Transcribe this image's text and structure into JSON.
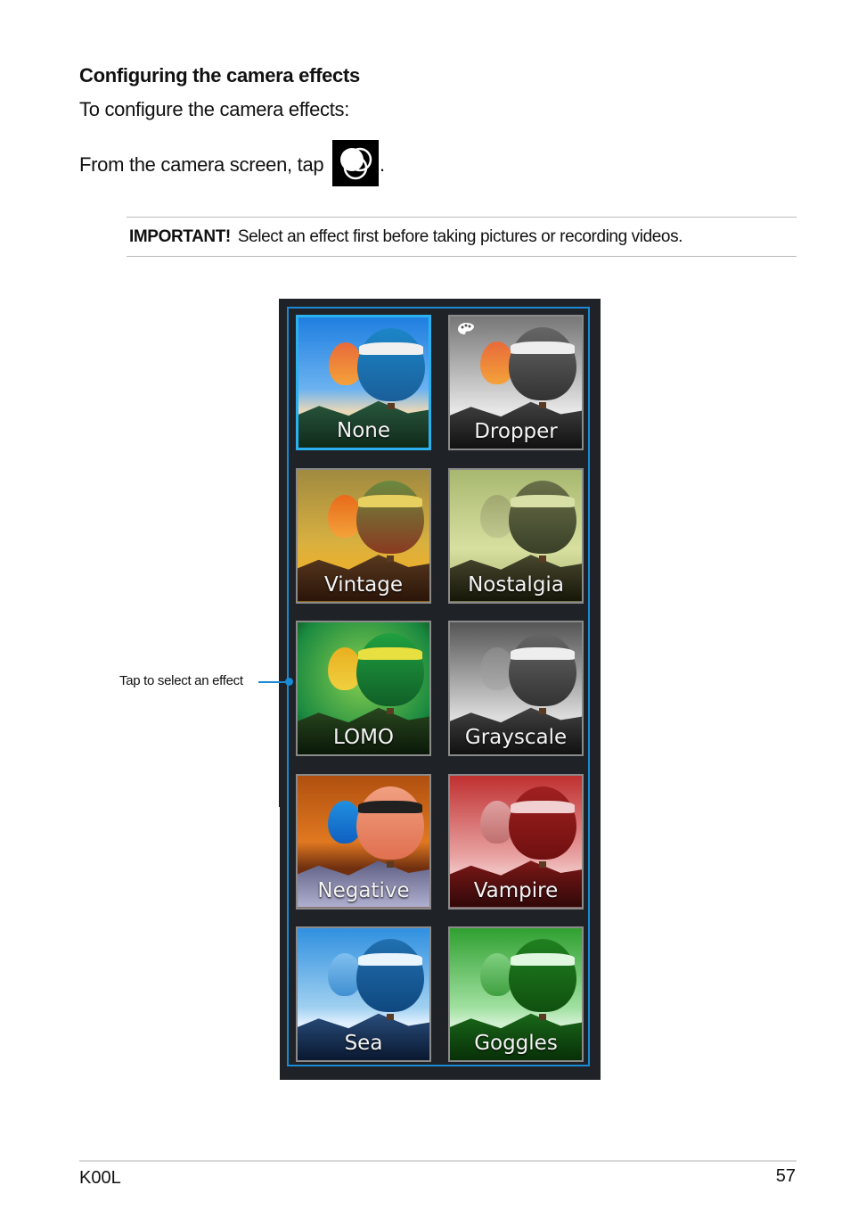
{
  "section": {
    "heading": "Configuring the camera effects",
    "intro": "To configure the camera effects:",
    "step_text": "From the camera screen, tap",
    "step_icon": "camera-effects-icon",
    "step_end": "."
  },
  "note": {
    "label": "IMPORTANT!",
    "text": "Select an effect first before taking pictures or recording videos."
  },
  "effects_panel": {
    "accent_color": "#1a8ad4",
    "selected": "None",
    "effects": [
      {
        "label": "None",
        "selected": true
      },
      {
        "label": "Dropper",
        "icon": "palette-icon"
      },
      {
        "label": "Vintage"
      },
      {
        "label": "Nostalgia"
      },
      {
        "label": "LOMO"
      },
      {
        "label": "Grayscale"
      },
      {
        "label": "Negative"
      },
      {
        "label": "Vampire"
      },
      {
        "label": "Sea"
      },
      {
        "label": "Goggles"
      }
    ]
  },
  "callout": {
    "text": "Tap to select an effect"
  },
  "footer": {
    "model": "K00L",
    "page_number": "57"
  }
}
